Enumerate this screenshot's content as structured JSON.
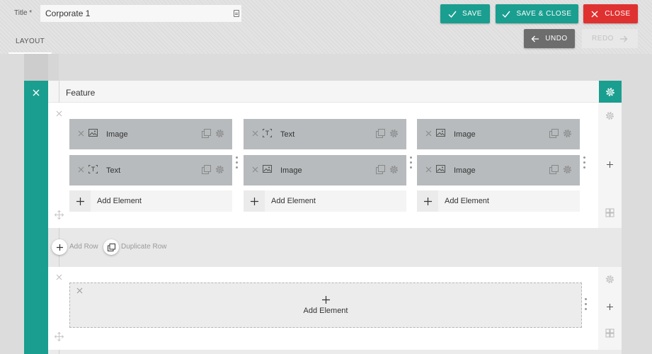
{
  "header": {
    "title_label": "Title *",
    "title_value": "Corporate 1",
    "tabs": [
      {
        "label": "LAYOUT"
      }
    ],
    "buttons": {
      "save": "SAVE",
      "save_close": "SAVE & CLOSE",
      "close": "CLOSE",
      "undo": "UNDO",
      "redo": "REDO"
    }
  },
  "colors": {
    "accent": "#1a9e8f",
    "danger": "#e03131",
    "undo": "#6d6d6d",
    "element_bg": "#b7bbbd"
  },
  "section": {
    "title": "Feature",
    "rows": [
      {
        "columns": [
          {
            "elements": [
              {
                "type_icon": "image-icon",
                "label": "Image"
              },
              {
                "type_icon": "text-icon",
                "label": "Text"
              }
            ],
            "add_label": "Add Element"
          },
          {
            "elements": [
              {
                "type_icon": "text-icon",
                "label": "Text"
              },
              {
                "type_icon": "image-icon",
                "label": "Image"
              }
            ],
            "add_label": "Add Element"
          },
          {
            "elements": [
              {
                "type_icon": "image-icon",
                "label": "Image"
              },
              {
                "type_icon": "image-icon",
                "label": "Image"
              }
            ],
            "add_label": "Add Element"
          }
        ]
      },
      {
        "empty_add_label": "Add Element"
      }
    ],
    "row_actions": {
      "add_row": "Add Row",
      "duplicate_row": "Duplicate Row"
    }
  }
}
